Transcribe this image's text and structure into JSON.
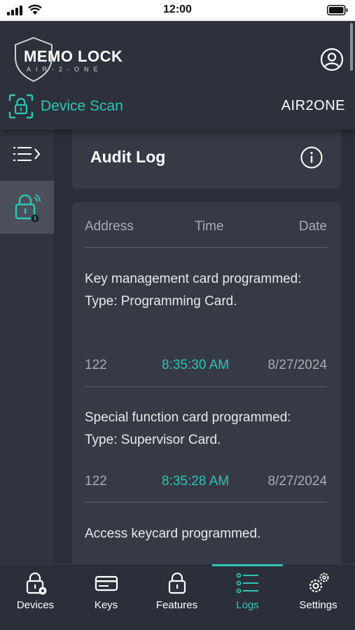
{
  "status_bar": {
    "time": "12:00"
  },
  "header": {
    "logo_title": "MEMO LOCK",
    "logo_subtitle": "AIR-2-ONE",
    "scan_label": "Device Scan",
    "device_name": "AIR2ONE"
  },
  "audit": {
    "title": "Audit Log"
  },
  "log_table": {
    "columns": [
      "Address",
      "Time",
      "Date"
    ],
    "entries": [
      {
        "text": "Key management card programmed: Type: Programming Card.",
        "address": "122",
        "time": "8:35:30 AM",
        "date": "8/27/2024"
      },
      {
        "text": "Special function card programmed: Type: Supervisor Card.",
        "address": "122",
        "time": "8:35:28 AM",
        "date": "8/27/2024"
      },
      {
        "text": "Access keycard programmed."
      }
    ]
  },
  "tabs": [
    {
      "label": "Devices",
      "icon": "lock-gear-icon"
    },
    {
      "label": "Keys",
      "icon": "card-icon"
    },
    {
      "label": "Features",
      "icon": "lock-icon"
    },
    {
      "label": "Logs",
      "icon": "list-icon",
      "active": true
    },
    {
      "label": "Settings",
      "icon": "gears-icon"
    }
  ],
  "colors": {
    "accent": "#2ec4b6",
    "background": "#2b2f3a",
    "card": "#363a45",
    "sidebar_active": "#4a4f59"
  }
}
